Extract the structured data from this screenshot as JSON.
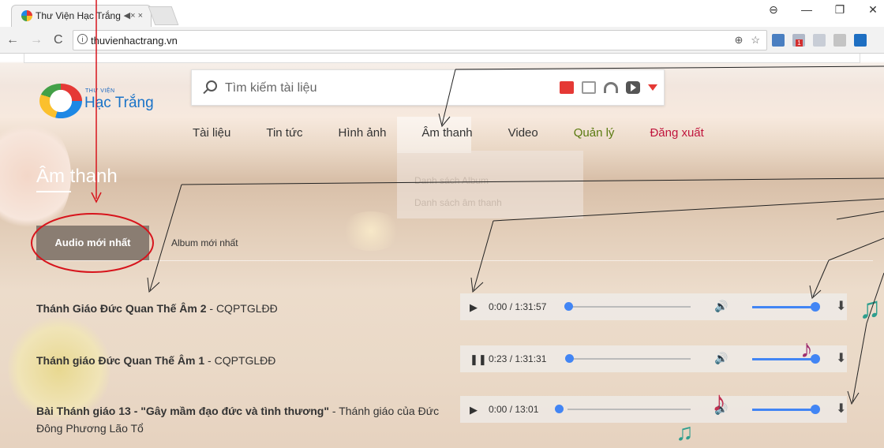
{
  "browser": {
    "tab_title": "Thư Viện Hạc Trắng",
    "tab_icons": "◀× ×",
    "url": "thuvienhactrang.vn",
    "win_controls": [
      "⊖",
      "—",
      "❐",
      "✕"
    ],
    "nav": [
      "←",
      "→",
      "C"
    ],
    "omni_right": [
      "⊕",
      "☆"
    ],
    "extension_badge": "1"
  },
  "site": {
    "logo_small": "THƯ VIỆN",
    "logo_main": "Hạc Trắng",
    "search_placeholder": "Tìm kiếm tài liệu"
  },
  "menu": [
    "Tài liệu",
    "Tin tức",
    "Hình ảnh",
    "Âm thanh",
    "Video",
    "Quản lý",
    "Đăng xuất"
  ],
  "dropdown": [
    "Danh sách Album",
    "Danh sách âm thanh"
  ],
  "page_title": "Âm thanh",
  "tabs": {
    "active": "Audio mới nhất",
    "inactive": "Album mới nhất"
  },
  "tracks": [
    {
      "title": "Thánh Giáo Đức Quan Thế Âm 2",
      "suffix": " - CQPTGLĐĐ",
      "control": "▶",
      "time": "0:00 / 1:31:57",
      "progress": 0.0
    },
    {
      "title": "Thánh giáo Đức Quan Thế Âm 1",
      "suffix": " - CQPTGLĐĐ",
      "control": "❚❚",
      "time": "0:23 / 1:31:31",
      "progress": 0.004
    },
    {
      "title": "Bài Thánh giáo 13 - \"Gây mầm đạo đức và tình thương\"",
      "suffix": " - Thánh giáo của Đức Đông Phương Lão Tổ",
      "control": "▶",
      "time": "0:00 / 13:01",
      "progress": 0.0
    }
  ],
  "colors": {
    "accent": "#4285f4",
    "active_tab": "#8a7d72",
    "annotation": "#d7141c",
    "menu_green": "#5a7a10",
    "menu_red": "#c0143c"
  },
  "icons": {
    "volume": "🔊",
    "download": "⬇"
  }
}
